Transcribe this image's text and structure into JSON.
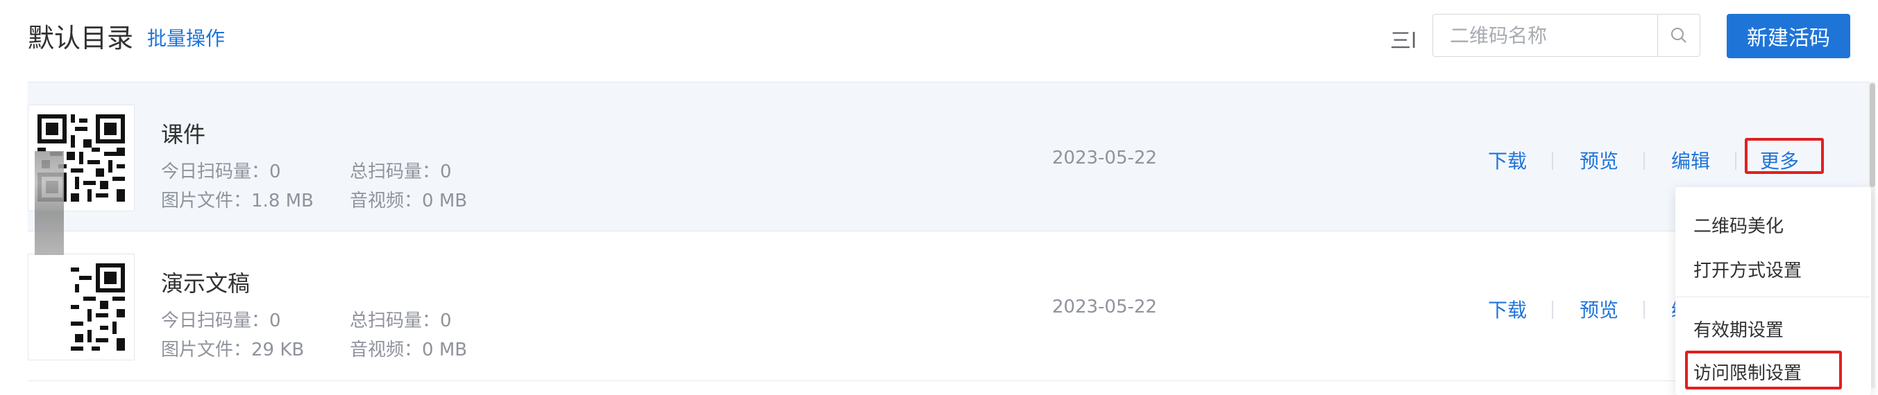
{
  "header": {
    "title": "默认目录",
    "batch_label": "批量操作",
    "sort_icon": "三l",
    "search_placeholder": "二维码名称",
    "new_button": "新建活码"
  },
  "labels": {
    "today_scans": "今日扫码量：",
    "total_scans": "总扫码量：",
    "image_files": "图片文件：",
    "audio_video": "音视频："
  },
  "items": [
    {
      "name": "课件",
      "today": "0",
      "total": "0",
      "image_size": "1.8 MB",
      "av_size": "0 MB",
      "date": "2023-05-22",
      "actions": [
        "下载",
        "预览",
        "编辑",
        "更多"
      ]
    },
    {
      "name": "演示文稿",
      "today": "0",
      "total": "0",
      "image_size": "29 KB",
      "av_size": "0 MB",
      "date": "2023-05-22",
      "actions": [
        "下载",
        "预览",
        "编"
      ]
    }
  ],
  "dropdown": {
    "items": [
      "二维码美化",
      "打开方式设置",
      "有效期设置",
      "访问限制设置"
    ]
  },
  "colors": {
    "accent": "#1f74d8",
    "highlight": "#e02020",
    "row_active_bg": "#f3f7fc"
  }
}
